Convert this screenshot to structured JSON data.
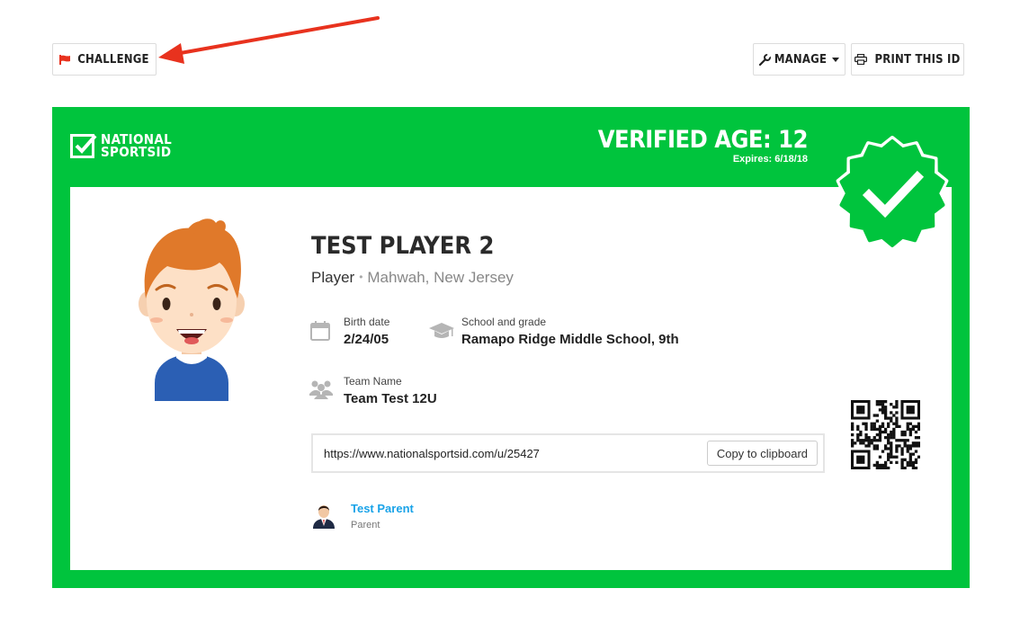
{
  "toolbar": {
    "challenge_label": "CHALLENGE",
    "manage_label": "MANAGE",
    "print_label": "PRINT THIS ID"
  },
  "card": {
    "brand_line1": "NATIONAL",
    "brand_line2": "SPORTSID",
    "verified_label": "VERIFIED AGE: 12",
    "expires_label": "Expires:",
    "expires_value": "6/18/18",
    "bg_color": "#00c43d"
  },
  "player": {
    "name": "TEST PLAYER 2",
    "role": "Player",
    "location": "Mahwah, New Jersey",
    "birth_label": "Birth date",
    "birth_value": "2/24/05",
    "school_label": "School and grade",
    "school_value": "Ramapo Ridge Middle School, 9th",
    "team_label": "Team Name",
    "team_value": "Team Test 12U"
  },
  "share": {
    "url": "https://www.nationalsportsid.com/u/25427",
    "copy_label": "Copy to clipboard"
  },
  "guardian": {
    "name": "Test Parent",
    "role": "Parent",
    "link_color": "#1aa3e8"
  },
  "icons": {
    "challenge": "flag-icon",
    "manage": "wrench-icon",
    "print": "printer-icon",
    "birth": "calendar-icon",
    "school": "graduation-cap-icon",
    "team": "group-icon"
  }
}
